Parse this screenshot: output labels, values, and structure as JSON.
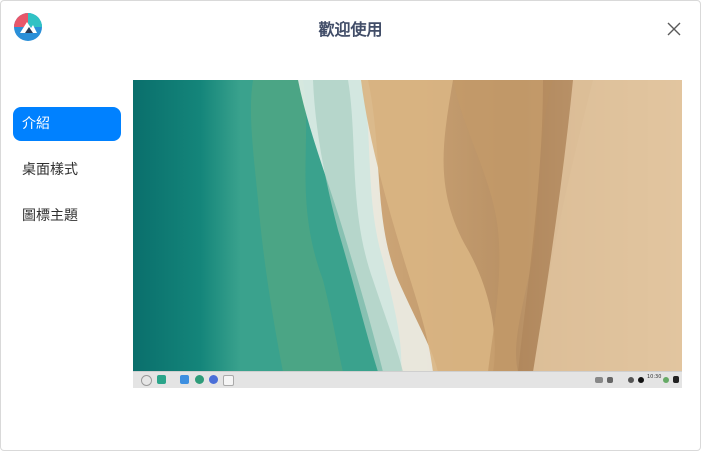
{
  "window": {
    "title": "歡迎使用"
  },
  "sidebar": {
    "items": [
      {
        "label": "介紹",
        "active": true
      },
      {
        "label": "桌面樣式",
        "active": false
      },
      {
        "label": "圖標主題",
        "active": false
      }
    ]
  },
  "preview": {
    "description_icons": [
      "launcher-icon",
      "multitask-icon",
      "file-manager-icon",
      "browser-icon",
      "app-store-icon",
      "terminal-icon"
    ],
    "dock_clock": "10:30"
  },
  "colors": {
    "accent": "#0081ff",
    "title": "#414d68",
    "sea": "#0f7d75",
    "sand": "#d9b386"
  }
}
